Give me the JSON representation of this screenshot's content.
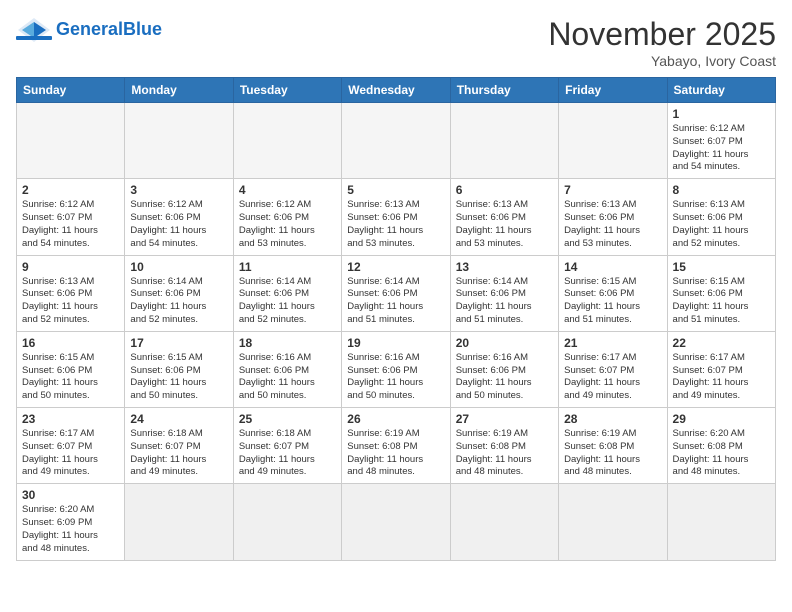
{
  "header": {
    "logo_general": "General",
    "logo_blue": "Blue",
    "month_title": "November 2025",
    "subtitle": "Yabayo, Ivory Coast"
  },
  "weekdays": [
    "Sunday",
    "Monday",
    "Tuesday",
    "Wednesday",
    "Thursday",
    "Friday",
    "Saturday"
  ],
  "weeks": [
    [
      {
        "day": "",
        "info": ""
      },
      {
        "day": "",
        "info": ""
      },
      {
        "day": "",
        "info": ""
      },
      {
        "day": "",
        "info": ""
      },
      {
        "day": "",
        "info": ""
      },
      {
        "day": "",
        "info": ""
      },
      {
        "day": "1",
        "info": "Sunrise: 6:12 AM\nSunset: 6:07 PM\nDaylight: 11 hours\nand 54 minutes."
      }
    ],
    [
      {
        "day": "2",
        "info": "Sunrise: 6:12 AM\nSunset: 6:07 PM\nDaylight: 11 hours\nand 54 minutes."
      },
      {
        "day": "3",
        "info": "Sunrise: 6:12 AM\nSunset: 6:06 PM\nDaylight: 11 hours\nand 54 minutes."
      },
      {
        "day": "4",
        "info": "Sunrise: 6:12 AM\nSunset: 6:06 PM\nDaylight: 11 hours\nand 53 minutes."
      },
      {
        "day": "5",
        "info": "Sunrise: 6:13 AM\nSunset: 6:06 PM\nDaylight: 11 hours\nand 53 minutes."
      },
      {
        "day": "6",
        "info": "Sunrise: 6:13 AM\nSunset: 6:06 PM\nDaylight: 11 hours\nand 53 minutes."
      },
      {
        "day": "7",
        "info": "Sunrise: 6:13 AM\nSunset: 6:06 PM\nDaylight: 11 hours\nand 53 minutes."
      },
      {
        "day": "8",
        "info": "Sunrise: 6:13 AM\nSunset: 6:06 PM\nDaylight: 11 hours\nand 52 minutes."
      }
    ],
    [
      {
        "day": "9",
        "info": "Sunrise: 6:13 AM\nSunset: 6:06 PM\nDaylight: 11 hours\nand 52 minutes."
      },
      {
        "day": "10",
        "info": "Sunrise: 6:14 AM\nSunset: 6:06 PM\nDaylight: 11 hours\nand 52 minutes."
      },
      {
        "day": "11",
        "info": "Sunrise: 6:14 AM\nSunset: 6:06 PM\nDaylight: 11 hours\nand 52 minutes."
      },
      {
        "day": "12",
        "info": "Sunrise: 6:14 AM\nSunset: 6:06 PM\nDaylight: 11 hours\nand 51 minutes."
      },
      {
        "day": "13",
        "info": "Sunrise: 6:14 AM\nSunset: 6:06 PM\nDaylight: 11 hours\nand 51 minutes."
      },
      {
        "day": "14",
        "info": "Sunrise: 6:15 AM\nSunset: 6:06 PM\nDaylight: 11 hours\nand 51 minutes."
      },
      {
        "day": "15",
        "info": "Sunrise: 6:15 AM\nSunset: 6:06 PM\nDaylight: 11 hours\nand 51 minutes."
      }
    ],
    [
      {
        "day": "16",
        "info": "Sunrise: 6:15 AM\nSunset: 6:06 PM\nDaylight: 11 hours\nand 50 minutes."
      },
      {
        "day": "17",
        "info": "Sunrise: 6:15 AM\nSunset: 6:06 PM\nDaylight: 11 hours\nand 50 minutes."
      },
      {
        "day": "18",
        "info": "Sunrise: 6:16 AM\nSunset: 6:06 PM\nDaylight: 11 hours\nand 50 minutes."
      },
      {
        "day": "19",
        "info": "Sunrise: 6:16 AM\nSunset: 6:06 PM\nDaylight: 11 hours\nand 50 minutes."
      },
      {
        "day": "20",
        "info": "Sunrise: 6:16 AM\nSunset: 6:06 PM\nDaylight: 11 hours\nand 50 minutes."
      },
      {
        "day": "21",
        "info": "Sunrise: 6:17 AM\nSunset: 6:07 PM\nDaylight: 11 hours\nand 49 minutes."
      },
      {
        "day": "22",
        "info": "Sunrise: 6:17 AM\nSunset: 6:07 PM\nDaylight: 11 hours\nand 49 minutes."
      }
    ],
    [
      {
        "day": "23",
        "info": "Sunrise: 6:17 AM\nSunset: 6:07 PM\nDaylight: 11 hours\nand 49 minutes."
      },
      {
        "day": "24",
        "info": "Sunrise: 6:18 AM\nSunset: 6:07 PM\nDaylight: 11 hours\nand 49 minutes."
      },
      {
        "day": "25",
        "info": "Sunrise: 6:18 AM\nSunset: 6:07 PM\nDaylight: 11 hours\nand 49 minutes."
      },
      {
        "day": "26",
        "info": "Sunrise: 6:19 AM\nSunset: 6:08 PM\nDaylight: 11 hours\nand 48 minutes."
      },
      {
        "day": "27",
        "info": "Sunrise: 6:19 AM\nSunset: 6:08 PM\nDaylight: 11 hours\nand 48 minutes."
      },
      {
        "day": "28",
        "info": "Sunrise: 6:19 AM\nSunset: 6:08 PM\nDaylight: 11 hours\nand 48 minutes."
      },
      {
        "day": "29",
        "info": "Sunrise: 6:20 AM\nSunset: 6:08 PM\nDaylight: 11 hours\nand 48 minutes."
      }
    ],
    [
      {
        "day": "30",
        "info": "Sunrise: 6:20 AM\nSunset: 6:09 PM\nDaylight: 11 hours\nand 48 minutes."
      },
      {
        "day": "",
        "info": ""
      },
      {
        "day": "",
        "info": ""
      },
      {
        "day": "",
        "info": ""
      },
      {
        "day": "",
        "info": ""
      },
      {
        "day": "",
        "info": ""
      },
      {
        "day": "",
        "info": ""
      }
    ]
  ]
}
